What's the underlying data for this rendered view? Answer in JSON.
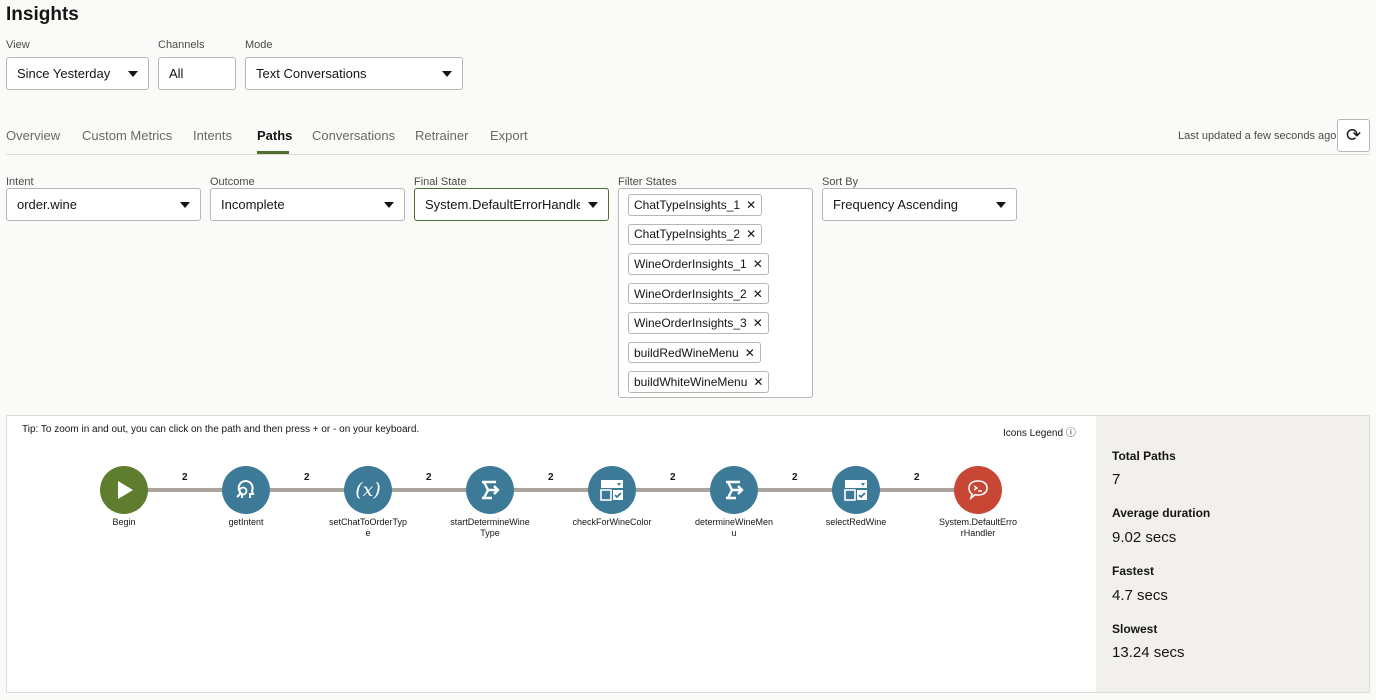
{
  "title": "Insights",
  "filters": {
    "view": {
      "label": "View",
      "value": "Since Yesterday"
    },
    "channels": {
      "label": "Channels",
      "value": "All"
    },
    "mode": {
      "label": "Mode",
      "value": "Text Conversations"
    }
  },
  "tabs": [
    "Overview",
    "Custom Metrics",
    "Intents",
    "Paths",
    "Conversations",
    "Retrainer",
    "Export"
  ],
  "active_tab": "Paths",
  "last_updated": "Last updated a few seconds ago",
  "paths_filters": {
    "intent": {
      "label": "Intent",
      "value": "order.wine"
    },
    "outcome": {
      "label": "Outcome",
      "value": "Incomplete"
    },
    "final_state": {
      "label": "Final State",
      "value": "System.DefaultErrorHandler"
    },
    "filter_states": {
      "label": "Filter States",
      "chips": [
        "ChatTypeInsights_1",
        "ChatTypeInsights_2",
        "WineOrderInsights_1",
        "WineOrderInsights_2",
        "WineOrderInsights_3",
        "buildRedWineMenu",
        "buildWhiteWineMenu"
      ]
    },
    "sort_by": {
      "label": "Sort By",
      "value": "Frequency Ascending"
    }
  },
  "tip": "Tip: To zoom in and out, you can click on the path and then press + or - on your keyboard.",
  "icons_legend": "Icons Legend",
  "colors": {
    "begin": "#5e7d2f",
    "state": "#3d7a98",
    "error": "#c74634",
    "edge": "#aaa49d",
    "active_tab": "#4f6b2e"
  },
  "path": {
    "nodes": [
      {
        "label": "Begin",
        "icon": "play-icon",
        "type": "begin"
      },
      {
        "label": "getIntent",
        "icon": "intent-search-icon",
        "type": "state"
      },
      {
        "label": "setChatToOrderType",
        "icon": "variable-icon",
        "type": "state"
      },
      {
        "label": "startDetermineWineType",
        "icon": "switch-icon",
        "type": "state"
      },
      {
        "label": "checkForWineColor",
        "icon": "form-icon",
        "type": "state"
      },
      {
        "label": "determineWineMenu",
        "icon": "switch-icon",
        "type": "state"
      },
      {
        "label": "selectRedWine",
        "icon": "form-icon",
        "type": "state"
      },
      {
        "label": "System.DefaultErrorHandler",
        "icon": "error-chat-icon",
        "type": "error"
      }
    ],
    "edge_counts": [
      "2",
      "2",
      "2",
      "2",
      "2",
      "2",
      "2"
    ]
  },
  "stats": {
    "total_paths": {
      "label": "Total Paths",
      "value": "7"
    },
    "average_duration": {
      "label": "Average duration",
      "value": "9.02 secs"
    },
    "fastest": {
      "label": "Fastest",
      "value": "4.7 secs"
    },
    "slowest": {
      "label": "Slowest",
      "value": "13.24 secs"
    }
  }
}
